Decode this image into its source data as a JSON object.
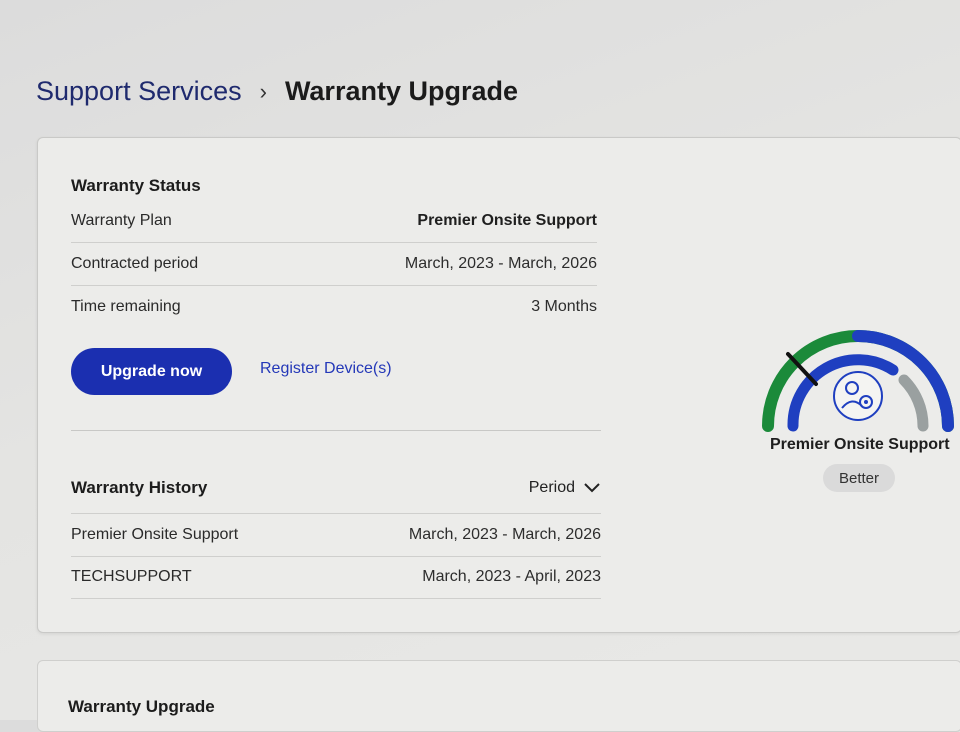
{
  "breadcrumb": {
    "parent": "Support Services",
    "separator": "›",
    "current": "Warranty Upgrade"
  },
  "status": {
    "title": "Warranty Status",
    "rows": [
      {
        "label": "Warranty Plan",
        "value": "Premier Onsite Support"
      },
      {
        "label": "Contracted period",
        "value": "March, 2023 - March, 2026"
      },
      {
        "label": "Time remaining",
        "value": "3 Months"
      }
    ],
    "upgrade_button": "Upgrade now",
    "register_link": "Register Device(s)"
  },
  "history": {
    "title": "Warranty History",
    "sort_label": "Period",
    "rows": [
      {
        "plan": "Premier Onsite Support",
        "period": "March, 2023 - March, 2026"
      },
      {
        "plan": "TECHSUPPORT",
        "period": "March, 2023 - April, 2023"
      }
    ]
  },
  "gauge": {
    "plan_name": "Premier Onsite Support",
    "tier_badge": "Better",
    "colors": {
      "outer": "#1b8a3a",
      "middle": "#1f3fc0",
      "inner_muted": "#9aa0a0",
      "needle": "#111111"
    },
    "icon": "support-agent-gear-icon"
  },
  "upgrade_section": {
    "title": "Warranty Upgrade"
  }
}
